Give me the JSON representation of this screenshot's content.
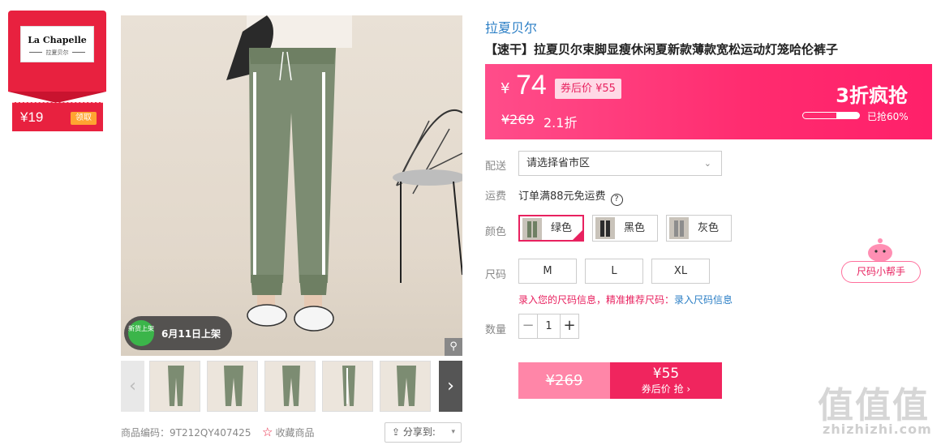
{
  "store_coupon": {
    "logo_en": "La Chapelle",
    "logo_cn": "拉夏贝尔",
    "price": "¥19",
    "claim_label": "领取"
  },
  "gallery": {
    "badge_circle": "新货上架",
    "badge_text": "6月11日上架",
    "zoom_icon": "magnifier-icon",
    "prev_icon": "‹",
    "next_icon": "›",
    "thumb_count": 6
  },
  "meta": {
    "code": "商品编码：9T212QY407425",
    "favorite_label": "收藏商品",
    "share_label": "分享到:"
  },
  "product": {
    "brand": "拉夏贝尔",
    "title": "【速干】拉夏贝尔束脚显瘦休闲夏新款薄款宽松运动灯笼哈伦裤子"
  },
  "price_panel": {
    "currency": "¥",
    "price": "74",
    "after_coupon": "券后价 ¥55",
    "original": "¥269",
    "discount": "2.1折",
    "flash_label": "3折疯抢",
    "progress_pct": 60,
    "progress_text": "已抢60%"
  },
  "delivery": {
    "label": "配送",
    "placeholder": "请选择省市区"
  },
  "shipping": {
    "label": "运费",
    "text": "订单满88元免运费",
    "help_icon": "?"
  },
  "colors": {
    "label": "颜色",
    "options": [
      {
        "name": "绿色",
        "selected": true,
        "swatch": "#6e7f63"
      },
      {
        "name": "黑色",
        "selected": false,
        "swatch": "#2b2b2b"
      },
      {
        "name": "灰色",
        "selected": false,
        "swatch": "#8d8d8d"
      }
    ]
  },
  "sizes": {
    "label": "尺码",
    "options": [
      "M",
      "L",
      "XL"
    ],
    "hint": "录入您的尺码信息，精准推荐尺码：",
    "hint_link": "录入尺码信息",
    "helper": "尺码小帮手"
  },
  "quantity": {
    "label": "数量",
    "value": "1",
    "minus": "−",
    "plus": "+"
  },
  "buy": {
    "original": "¥269",
    "price": "¥55",
    "label": "券后价 抢 ›"
  },
  "watermark": {
    "text": "值值值",
    "url": "zhizhizhi.com"
  },
  "colors_theme": {
    "accent": "#f0255e",
    "brand_blue": "#2a7ec5",
    "coupon_red": "#e8213f"
  }
}
